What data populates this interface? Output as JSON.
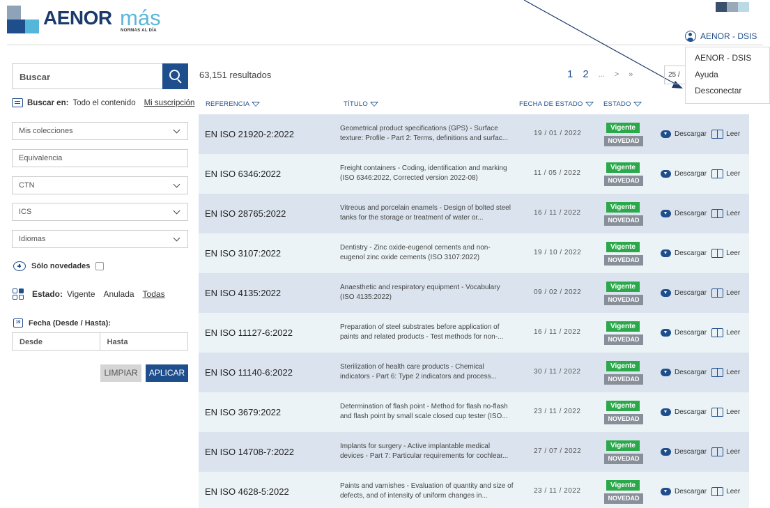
{
  "header": {
    "logo_word": "AENOR",
    "logo_accent": "más",
    "logo_tagline": "NORMAS AL DÍA",
    "user_label": "AENOR - DSIS"
  },
  "user_menu": {
    "items": [
      "AENOR - DSIS",
      "Ayuda",
      "Desconectar"
    ]
  },
  "sidebar": {
    "search_placeholder": "Buscar",
    "buscar_en_label": "Buscar en:",
    "buscar_en_options": [
      "Todo el contenido",
      "Mi suscripción"
    ],
    "mis_colecciones": "Mis colecciones",
    "equivalencia": "Equivalencia",
    "ctn": "CTN",
    "ics": "ICS",
    "idiomas": "Idiomas",
    "solo_novedades": "Sólo novedades",
    "estado_label": "Estado:",
    "estado_options": [
      "Vigente",
      "Anulada",
      "Todas"
    ],
    "fecha_label": "Fecha (Desde / Hasta):",
    "calendar_number": "19",
    "desde": "Desde",
    "hasta": "Hasta",
    "limpiar": "LIMPIAR",
    "aplicar": "APLICAR"
  },
  "results": {
    "count": "63,151 resultados",
    "pages": [
      "1",
      "2",
      "...",
      ">",
      "»"
    ],
    "per_page": "25 /",
    "columns": {
      "referencia": "REFERENCIA",
      "titulo": "TÍTULO",
      "fecha": "FECHA DE ESTADO",
      "estado": "ESTADO"
    },
    "rows": [
      {
        "ref": "EN ISO 21920-2:2022",
        "title": "Geometrical product specifications (GPS) - Surface texture: Profile - Part 2: Terms, definitions and surfac...",
        "date": "19 / 01 / 2022",
        "status": "Vigente",
        "badge": "NOVEDAD",
        "download": "Descargar",
        "read": "Leer"
      },
      {
        "ref": "EN ISO 6346:2022",
        "title": "Freight containers - Coding, identification and marking (ISO 6346:2022, Corrected version 2022-08)",
        "date": "11 / 05 / 2022",
        "status": "Vigente",
        "badge": "NOVEDAD",
        "download": "Descargar",
        "read": "Leer"
      },
      {
        "ref": "EN ISO 28765:2022",
        "title": "Vitreous and porcelain enamels - Design of bolted steel tanks for the storage or treatment of water or...",
        "date": "16 / 11 / 2022",
        "status": "Vigente",
        "badge": "NOVEDAD",
        "download": "Descargar",
        "read": "Leer"
      },
      {
        "ref": "EN ISO 3107:2022",
        "title": "Dentistry - Zinc oxide-eugenol cements and non-eugenol zinc oxide cements (ISO 3107:2022)",
        "date": "19 / 10 / 2022",
        "status": "Vigente",
        "badge": "NOVEDAD",
        "download": "Descargar",
        "read": "Leer"
      },
      {
        "ref": "EN ISO 4135:2022",
        "title": "Anaesthetic and respiratory equipment - Vocabulary (ISO 4135:2022)",
        "date": "09 / 02 / 2022",
        "status": "Vigente",
        "badge": "NOVEDAD",
        "download": "Descargar",
        "read": "Leer"
      },
      {
        "ref": "EN ISO 11127-6:2022",
        "title": "Preparation of steel substrates before application of paints and related products - Test methods for non-...",
        "date": "16 / 11 / 2022",
        "status": "Vigente",
        "badge": "NOVEDAD",
        "download": "Descargar",
        "read": "Leer"
      },
      {
        "ref": "EN ISO 11140-6:2022",
        "title": "Sterilization of health care products - Chemical indicators - Part 6: Type 2 indicators and process...",
        "date": "30 / 11 / 2022",
        "status": "Vigente",
        "badge": "NOVEDAD",
        "download": "Descargar",
        "read": "Leer"
      },
      {
        "ref": "EN ISO 3679:2022",
        "title": "Determination of flash point - Method for flash no-flash and flash point by small scale closed cup tester (ISO...",
        "date": "23 / 11 / 2022",
        "status": "Vigente",
        "badge": "NOVEDAD",
        "download": "Descargar",
        "read": "Leer"
      },
      {
        "ref": "EN ISO 14708-7:2022",
        "title": "Implants for surgery - Active implantable medical devices - Part 7: Particular requirements for cochlear...",
        "date": "27 / 07 / 2022",
        "status": "Vigente",
        "badge": "NOVEDAD",
        "download": "Descargar",
        "read": "Leer"
      },
      {
        "ref": "EN ISO 4628-5:2022",
        "title": "Paints and varnishes - Evaluation of quantity and size of defects, and of intensity of uniform changes in...",
        "date": "23 / 11 / 2022",
        "status": "Vigente",
        "badge": "NOVEDAD",
        "download": "Descargar",
        "read": "Leer"
      }
    ]
  },
  "colors": {
    "brand_dark": "#1f4e8c",
    "brand_light": "#5bb6d8",
    "vigente": "#2aa84a",
    "novedad": "#888f99",
    "row_odd": "#dbe4ee",
    "row_even": "#ebf3f6"
  }
}
